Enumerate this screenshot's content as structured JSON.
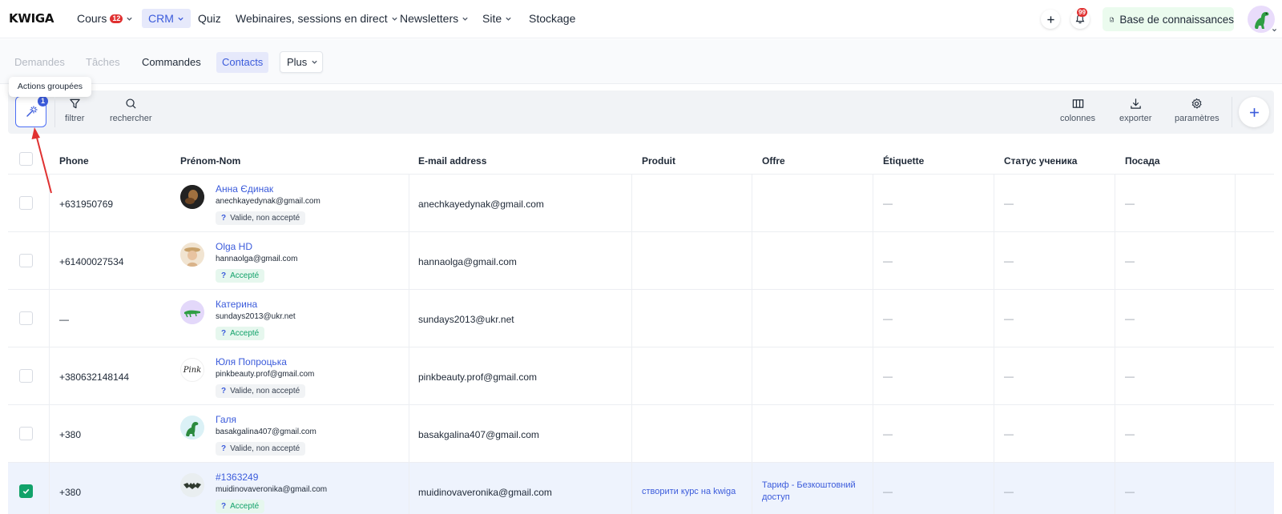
{
  "logo": "KWIGA",
  "nav": {
    "cours": "Cours",
    "cours_badge": "12",
    "crm": "CRM",
    "quiz": "Quiz",
    "webinaires": "Webinaires, sessions en direct",
    "newsletters": "Newsletters",
    "site": "Site",
    "stockage": "Stockage"
  },
  "header_right": {
    "notif_count": "99",
    "knowledge_base": "Base de connaissances"
  },
  "subnav": {
    "demandes": "Demandes",
    "taches": "Tâches",
    "commandes": "Commandes",
    "contacts": "Contacts",
    "plus": "Plus"
  },
  "toolbar": {
    "tooltip": "Actions groupées",
    "selected_count": "1",
    "filter": "filtrer",
    "search": "rechercher",
    "columns": "colonnes",
    "export": "exporter",
    "settings": "paramètres"
  },
  "table": {
    "headers": [
      "Phone",
      "Prénom-Nom",
      "E-mail address",
      "Produit",
      "Offre",
      "Étiquette",
      "Статус ученика",
      "Посада"
    ],
    "empty": "—",
    "rows": [
      {
        "phone": "+631950769",
        "name": "Анна Єдинак",
        "email_small": "anechkayedynak@gmail.com",
        "status": "Valide, non accepté",
        "email": "anechkayedynak@gmail.com",
        "product": "",
        "offer_line1": "",
        "offer_line2": "",
        "tag": "—",
        "student_status": "—",
        "position": "—"
      },
      {
        "phone": "+61400027534",
        "name": "Olga HD",
        "email_small": "hannaolga@gmail.com",
        "status": "Accepté",
        "email": "hannaolga@gmail.com",
        "product": "",
        "offer_line1": "",
        "offer_line2": "",
        "tag": "—",
        "student_status": "—",
        "position": "—"
      },
      {
        "phone": "—",
        "name": "Катерина",
        "email_small": "sundays2013@ukr.net",
        "status": "Accepté",
        "email": "sundays2013@ukr.net",
        "product": "",
        "offer_line1": "",
        "offer_line2": "",
        "tag": "—",
        "student_status": "—",
        "position": "—"
      },
      {
        "phone": "+380632148144",
        "name": "Юля Попроцька",
        "email_small": "pinkbeauty.prof@gmail.com",
        "status": "Valide, non accepté",
        "email": "pinkbeauty.prof@gmail.com",
        "product": "",
        "offer_line1": "",
        "offer_line2": "",
        "tag": "—",
        "student_status": "—",
        "position": "—",
        "avatar_text": "Pink"
      },
      {
        "phone": "+380",
        "name": "Галя",
        "email_small": "basakgalina407@gmail.com",
        "status": "Valide, non accepté",
        "email": "basakgalina407@gmail.com",
        "product": "",
        "offer_line1": "",
        "offer_line2": "",
        "tag": "—",
        "student_status": "—",
        "position": "—"
      },
      {
        "phone": "+380",
        "name": "#1363249",
        "email_small": "muidinovaveronika@gmail.com",
        "status": "Accepté",
        "email": "muidinovaveronika@gmail.com",
        "product": "створити курс на kwiga",
        "offer_line1": "Тариф - Безкоштовний",
        "offer_line2": "доступ",
        "tag": "—",
        "student_status": "—",
        "position": "—"
      }
    ]
  },
  "icons": {
    "bulk_actions": "magic-wand-icon",
    "filter": "funnel-icon",
    "search": "magnifier-icon",
    "columns": "columns-icon",
    "export": "download-icon",
    "settings": "gear-icon",
    "add": "plus-icon",
    "notifications": "bell-icon",
    "knowledge_base": "document-icon"
  },
  "colors": {
    "accent": "#3b5bdb",
    "accepted": "#12a26a",
    "badge": "#e03131",
    "arrow": "#e03131"
  }
}
